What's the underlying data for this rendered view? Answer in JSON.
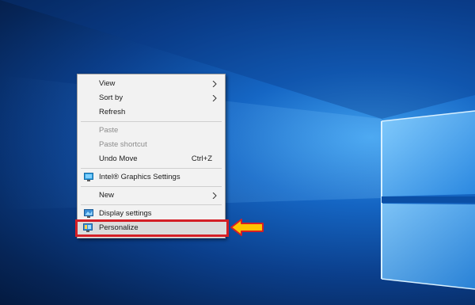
{
  "context_menu": {
    "items": [
      {
        "label": "View",
        "submenu": true
      },
      {
        "label": "Sort by",
        "submenu": true
      },
      {
        "label": "Refresh"
      },
      {
        "label": "Paste",
        "disabled": true
      },
      {
        "label": "Paste shortcut",
        "disabled": true
      },
      {
        "label": "Undo Move",
        "accelerator": "Ctrl+Z"
      },
      {
        "label": "Intel® Graphics Settings",
        "icon": "intel-graphics-icon"
      },
      {
        "label": "New",
        "submenu": true
      },
      {
        "label": "Display settings",
        "icon": "display-icon"
      },
      {
        "label": "Personalize",
        "icon": "personalize-icon",
        "highlighted": true
      }
    ]
  },
  "colors": {
    "highlight_border": "#d41f26",
    "arrow_fill": "#ffc400",
    "arrow_stroke": "#d41f26",
    "desktop_accent": "#1566c4"
  }
}
